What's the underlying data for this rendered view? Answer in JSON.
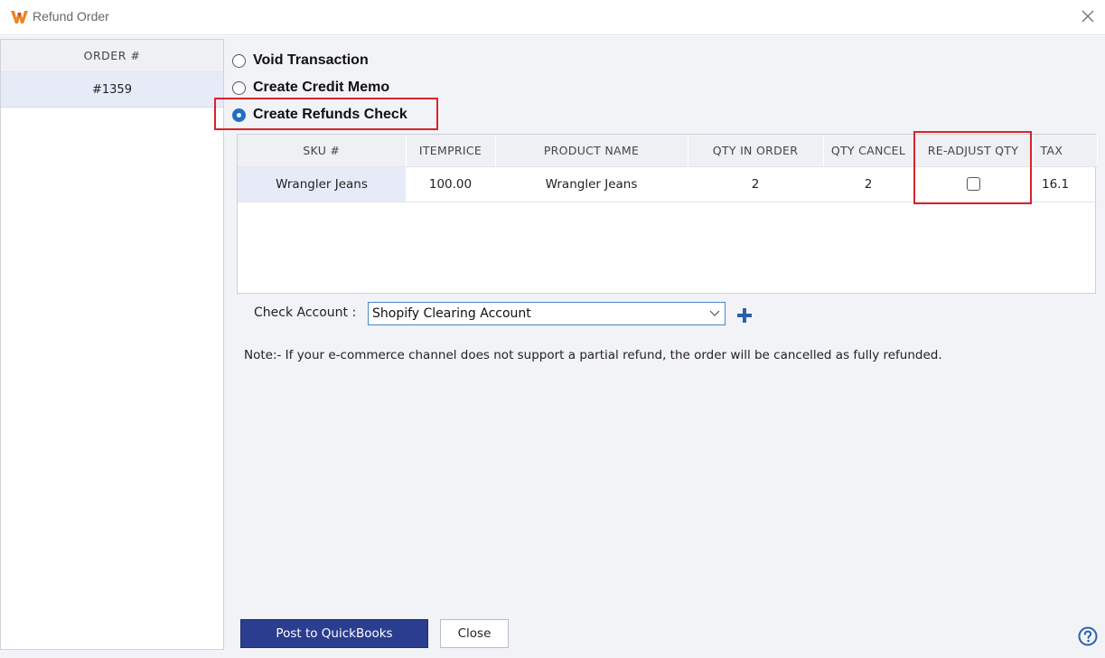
{
  "window": {
    "title": "Refund Order",
    "logo_icon": "w-logo-icon",
    "close_icon": "close-icon"
  },
  "orders": {
    "header": "ORDER #",
    "items": [
      {
        "number": "#1359",
        "selected": true
      }
    ]
  },
  "options": [
    {
      "label": "Void Transaction",
      "checked": false
    },
    {
      "label": "Create Credit Memo",
      "checked": false
    },
    {
      "label": "Create Refunds Check",
      "checked": true
    }
  ],
  "table": {
    "columns": [
      "SKU #",
      "ITEMPRICE",
      "PRODUCT NAME",
      "QTY IN ORDER",
      "QTY CANCEL",
      "RE-ADJUST QTY",
      "TAX"
    ],
    "rows": [
      {
        "sku": "Wrangler Jeans",
        "itemprice": "100.00",
        "product_name": "Wrangler Jeans",
        "qty_in_order": "2",
        "qty_cancel": "2",
        "readjust_qty": false,
        "tax": "16.1"
      }
    ]
  },
  "check_account": {
    "label": "Check Account :",
    "value": "Shopify Clearing Account",
    "add_icon": "plus-icon"
  },
  "note": "Note:- If your e-commerce channel does not support a partial refund, the order will be cancelled as fully refunded.",
  "buttons": {
    "post": "Post to QuickBooks",
    "close": "Close"
  },
  "help_icon": "help-icon",
  "colors": {
    "highlight": "#d9232b",
    "primary_button": "#2b3d8f",
    "radio_checked": "#1e6ec8",
    "add_icon": "#2b5fb0",
    "logo": "#e8862a"
  }
}
